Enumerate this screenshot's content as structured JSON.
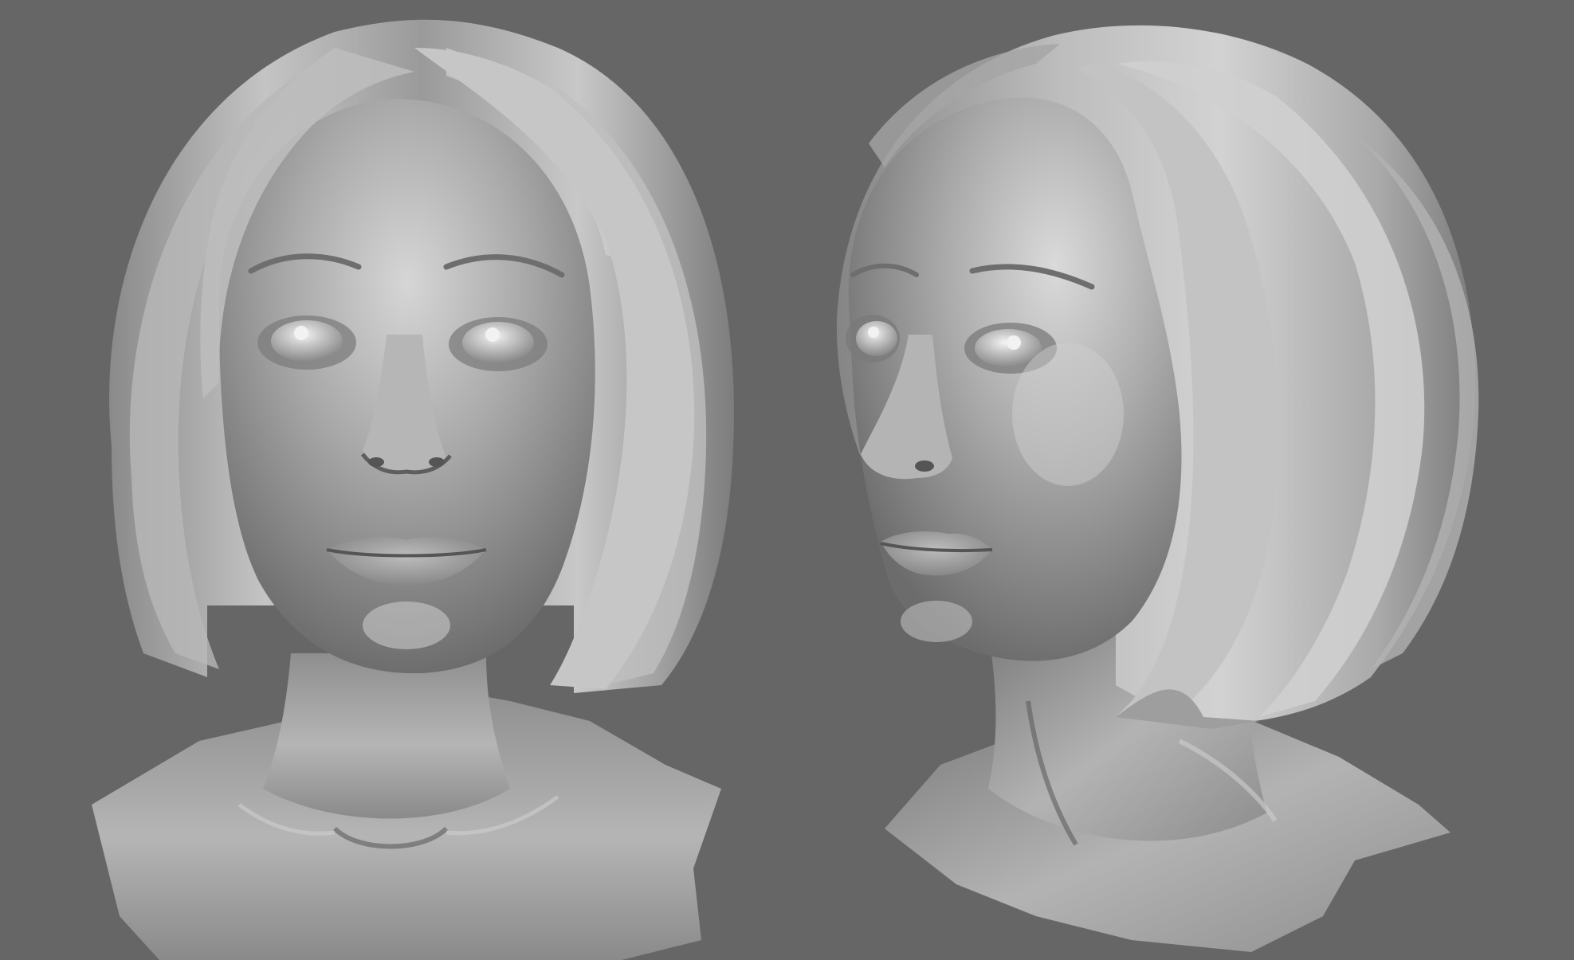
{
  "scene": {
    "background_color": "#666666",
    "model_material": "grey clay",
    "views": [
      {
        "name": "front-view",
        "description_icon": "sculpt-bust-front"
      },
      {
        "name": "three-quarter-view",
        "description_icon": "sculpt-bust-three-quarter"
      }
    ]
  },
  "colors": {
    "background": "#666666",
    "clay_light": "#d9d9d9",
    "clay_mid": "#a6a6a6",
    "clay_dark": "#6e6e6e",
    "clay_shadow": "#4f4f4f",
    "eye_highlight": "#f2f2f2"
  }
}
